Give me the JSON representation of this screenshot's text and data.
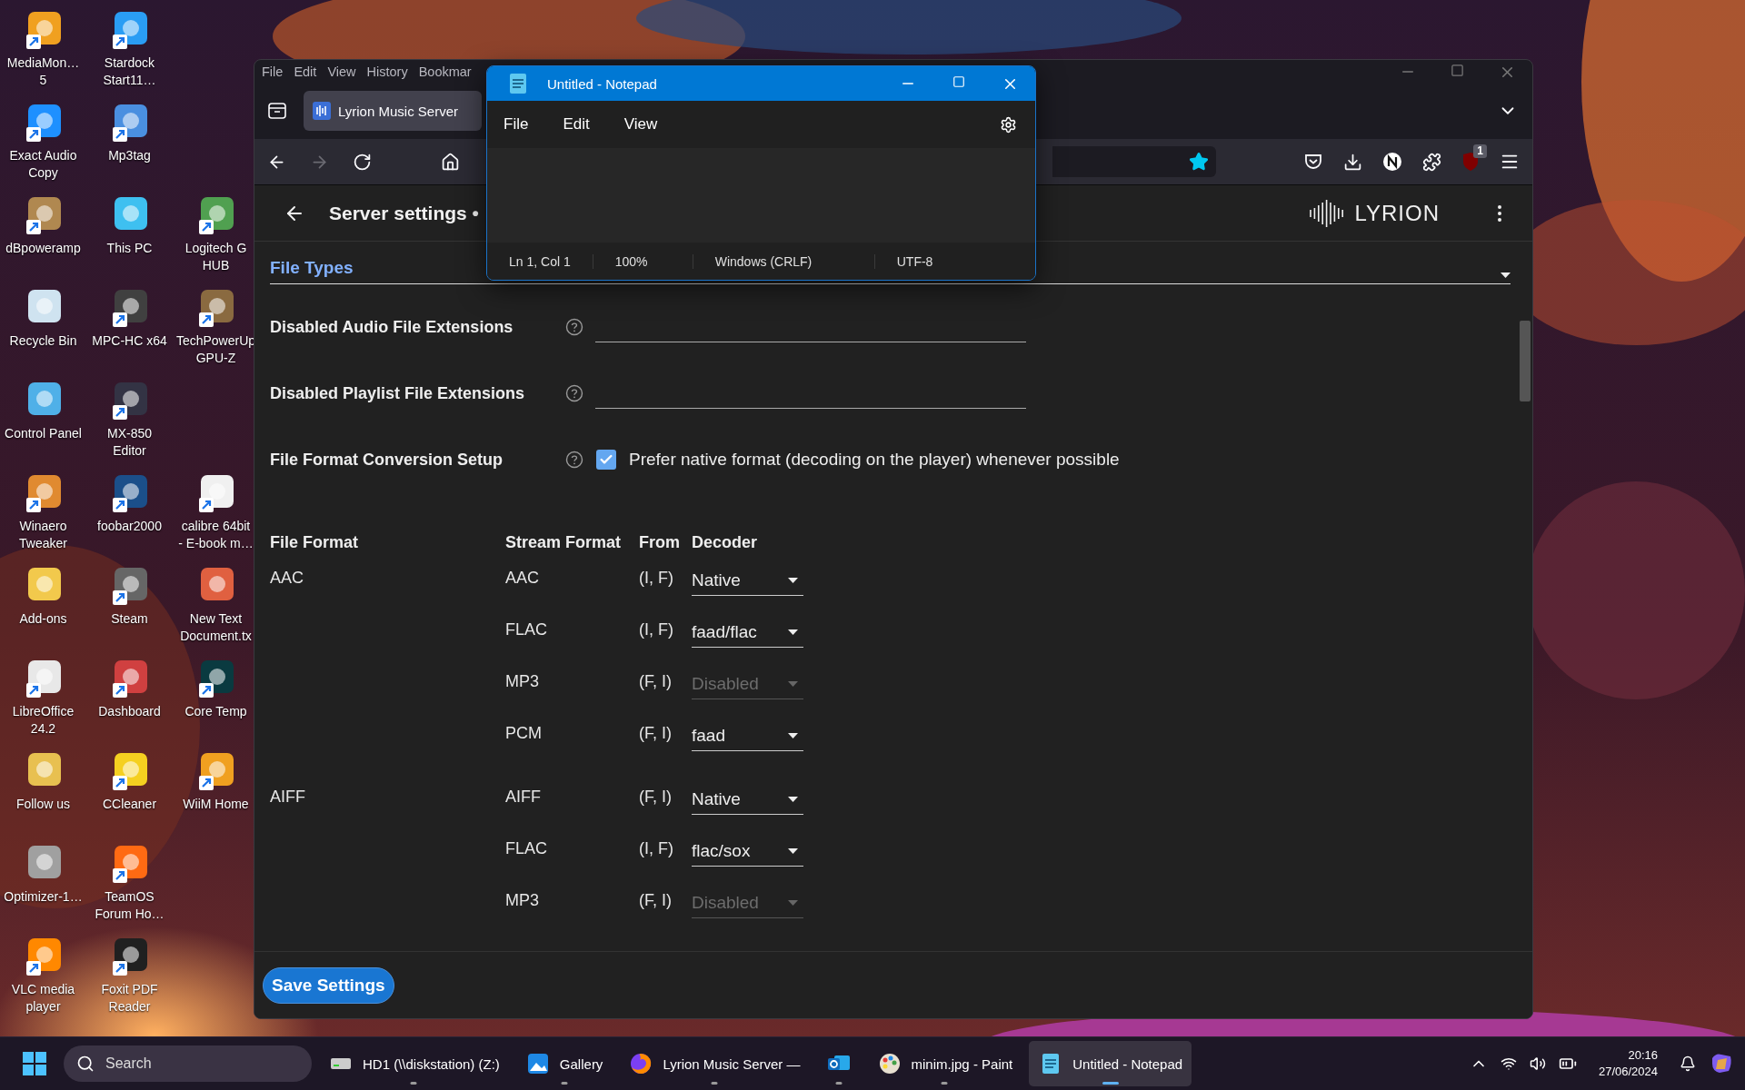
{
  "desktop": {
    "columns": [
      {
        "icons": [
          {
            "label": "MediaMon…\n5",
            "shortcut": true
          },
          {
            "label": "Exact Audio\nCopy",
            "shortcut": true
          },
          {
            "label": "dBpoweramp",
            "shortcut": true
          },
          {
            "label": "Recycle Bin",
            "shortcut": false
          },
          {
            "label": "Control Panel",
            "shortcut": false
          },
          {
            "label": "Winaero\nTweaker",
            "shortcut": true
          },
          {
            "label": "Add-ons",
            "shortcut": false
          },
          {
            "label": "LibreOffice\n24.2",
            "shortcut": true
          },
          {
            "label": "Follow us",
            "shortcut": false
          },
          {
            "label": "Optimizer-1…",
            "shortcut": false
          },
          {
            "label": "VLC media\nplayer",
            "shortcut": true
          }
        ]
      },
      {
        "icons": [
          {
            "label": "Stardock\nStart11…",
            "shortcut": true
          },
          {
            "label": "Mp3tag",
            "shortcut": true
          },
          {
            "label": "This PC",
            "shortcut": false
          },
          {
            "label": "MPC-HC x64",
            "shortcut": true
          },
          {
            "label": "MX-850\nEditor",
            "shortcut": true
          },
          {
            "label": "foobar2000",
            "shortcut": true
          },
          {
            "label": "Steam",
            "shortcut": true
          },
          {
            "label": "Dashboard",
            "shortcut": true
          },
          {
            "label": "CCleaner",
            "shortcut": true
          },
          {
            "label": "TeamOS\nForum Ho…",
            "shortcut": true
          },
          {
            "label": "Foxit PDF\nReader",
            "shortcut": true
          }
        ]
      },
      {
        "icons": [
          {
            "label": "Logitech G\nHUB",
            "shortcut": true
          },
          {
            "label": "TechPowerUp\nGPU-Z",
            "shortcut": true
          },
          {
            "label": "calibre 64bit\n- E-book m…",
            "shortcut": true
          },
          {
            "label": "New Text\nDocument.tx",
            "shortcut": false
          },
          {
            "label": "Core Temp",
            "shortcut": true
          },
          {
            "label": "WiiM Home",
            "shortcut": true
          }
        ]
      }
    ]
  },
  "browser": {
    "menu": [
      "File",
      "Edit",
      "View",
      "History",
      "Bookmar"
    ],
    "tab": {
      "title": "Lyrion Music Server"
    },
    "nav": [
      {
        "kind": "back",
        "disabled": false
      },
      {
        "kind": "forward",
        "disabled": true
      },
      {
        "kind": "reload",
        "disabled": false
      },
      {
        "kind": "home",
        "disabled": false
      }
    ],
    "bookmarked": true,
    "extension_badge": "1"
  },
  "page": {
    "title": "Server settings •",
    "logo": "LYRION",
    "section": {
      "title": "File Types"
    },
    "fields": [
      {
        "label": "Disabled Audio File Extensions"
      },
      {
        "label": "Disabled Playlist File Extensions"
      }
    ],
    "conversion": {
      "label": "File Format Conversion Setup",
      "checked": true,
      "option": "Prefer native format (decoding on the player) whenever possible"
    },
    "table": {
      "columns": [
        "File Format",
        "Stream Format",
        "From",
        "Decoder"
      ],
      "groups": [
        {
          "format": "AAC",
          "rows": [
            {
              "stream": "AAC",
              "from": "(I, F)",
              "decoder": "Native",
              "disabled": false
            },
            {
              "stream": "FLAC",
              "from": "(I, F)",
              "decoder": "faad/flac",
              "disabled": false
            },
            {
              "stream": "MP3",
              "from": "(F, I)",
              "decoder": "Disabled",
              "disabled": true
            },
            {
              "stream": "PCM",
              "from": "(F, I)",
              "decoder": "faad",
              "disabled": false
            }
          ]
        },
        {
          "format": "AIFF",
          "rows": [
            {
              "stream": "AIFF",
              "from": "(F, I)",
              "decoder": "Native",
              "disabled": false
            },
            {
              "stream": "FLAC",
              "from": "(I, F)",
              "decoder": "flac/sox",
              "disabled": false
            },
            {
              "stream": "MP3",
              "from": "(F, I)",
              "decoder": "Disabled",
              "disabled": true
            }
          ]
        }
      ]
    },
    "save_button": "Save Settings"
  },
  "notepad": {
    "title": "Untitled - Notepad",
    "menu": [
      "File",
      "Edit",
      "View"
    ],
    "status": [
      "Ln 1, Col 1",
      "100%",
      "Windows (CRLF)",
      "UTF-8"
    ]
  },
  "taskbar": {
    "search": {
      "placeholder": "Search"
    },
    "items": [
      {
        "kind": "drive",
        "label": "HD1 (\\\\diskstation) (Z:)",
        "selected": false
      },
      {
        "kind": "gallery",
        "label": "Gallery",
        "selected": false
      },
      {
        "kind": "browser",
        "label": "Lyrion Music Server — ",
        "selected": false
      },
      {
        "kind": "mail",
        "selected": false
      },
      {
        "kind": "paint",
        "label": "minim.jpg - Paint",
        "selected": false
      },
      {
        "kind": "notepad",
        "label": "Untitled - Notepad",
        "selected": true
      }
    ],
    "time": "20:16",
    "date": "27/06/2024"
  }
}
